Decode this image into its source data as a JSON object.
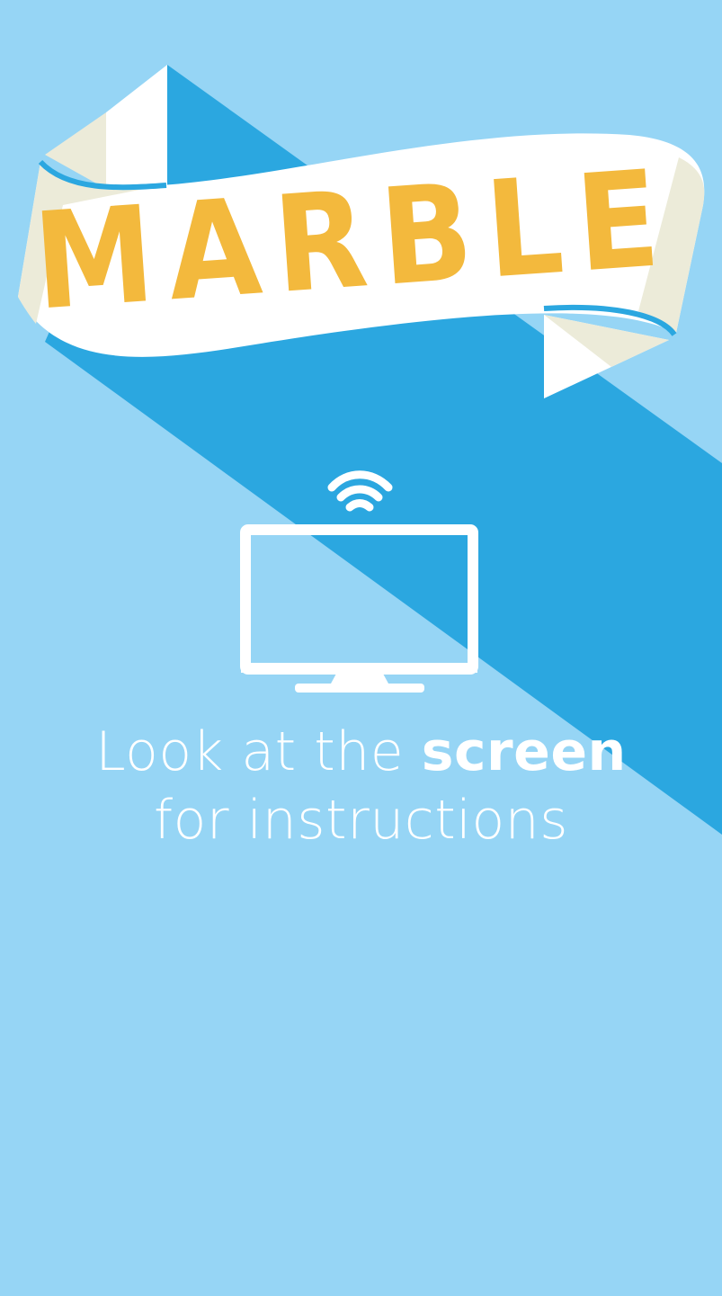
{
  "app": {
    "brand_title": "MARBLE"
  },
  "message": {
    "line1_prefix": "Look at the ",
    "line1_emphasis": "screen",
    "line2": "for instructions"
  },
  "icons": {
    "cast": "tv-with-wifi-signal-icon"
  },
  "colors": {
    "background_light": "#96d5f5",
    "background_dark": "#2ba7e0",
    "banner_white": "#ffffff",
    "banner_fold": "#ecebd9",
    "title_gold": "#f3b93d",
    "text_white": "#ffffff"
  }
}
